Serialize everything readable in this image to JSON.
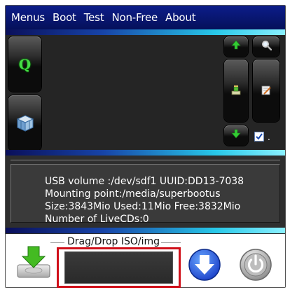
{
  "menu": {
    "items": [
      "Menus",
      "Boot",
      "Test",
      "Non-Free",
      "About"
    ]
  },
  "toolbar": {
    "qemu_button_label": "Q",
    "checkbox_suffix": ".",
    "checkbox_checked": true
  },
  "info": {
    "line1": "USB volume :/dev/sdf1 UUID:DD13-7038",
    "line2": "Mounting point:/media/superbootus",
    "line3": "Size:3843Mio Used:11Mio Free:3832Mio",
    "line4": "Number of LiveCDs:0"
  },
  "dropzone": {
    "label": "Drag/Drop ISO/img"
  },
  "icons": {
    "qemu": "q-letter-icon",
    "virtualbox": "virtualbox-cube-icon",
    "up": "arrow-up-icon",
    "search": "magnifier-icon",
    "install": "install-disk-icon",
    "edit": "edit-note-icon",
    "down": "arrow-down-icon",
    "download_disk": "download-to-disk-icon",
    "blue_down": "blue-down-arrow-icon",
    "power": "power-icon"
  },
  "colors": {
    "accent_green": "#33cc33",
    "drop_border": "#d0101a",
    "menubar": "#0c1d8a"
  }
}
